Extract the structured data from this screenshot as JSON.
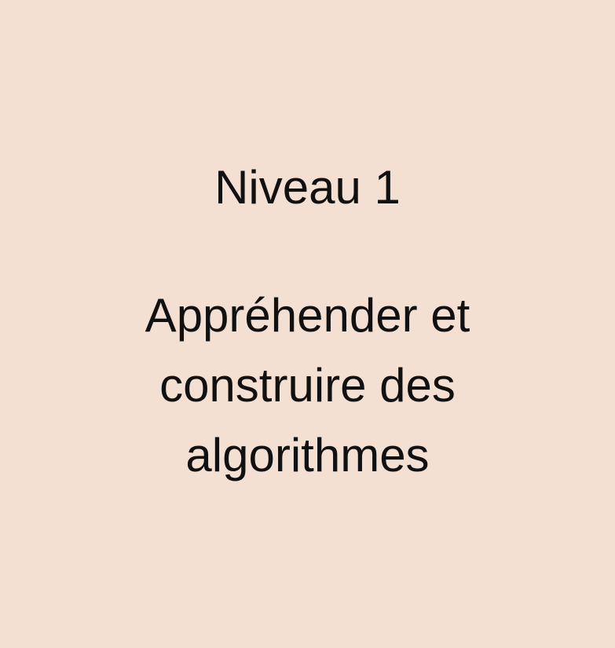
{
  "card": {
    "level_label": "Niveau 1",
    "subtitle_lines": [
      "Appréhender et",
      "construire des",
      "algorithmes"
    ],
    "background_color": "#f4e0d2",
    "text_color": "#111111"
  }
}
